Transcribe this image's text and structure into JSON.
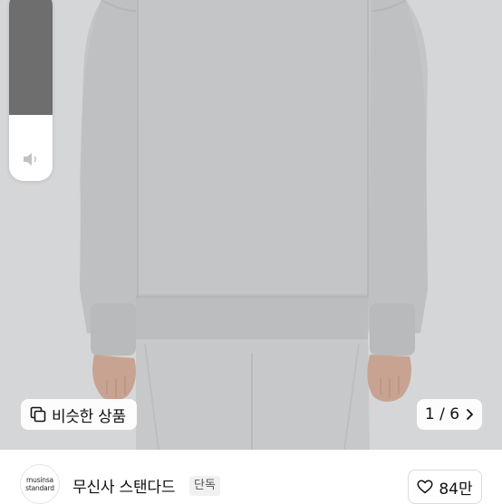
{
  "product_image": {
    "alt_icon": "product-photo",
    "counter": "1 / 6",
    "counter_icon": "chevron-right-icon"
  },
  "volume": {
    "level": 0.65,
    "icon": "speaker-icon"
  },
  "similar_products": {
    "label": "비슷한 상품",
    "icon": "copy-search-icon"
  },
  "brand": {
    "logo_line1": "musinsa",
    "logo_line2": "standard",
    "name": "무신사 스탠다드",
    "badge": "단독"
  },
  "like": {
    "icon": "heart-outline-icon",
    "count": "84만"
  }
}
